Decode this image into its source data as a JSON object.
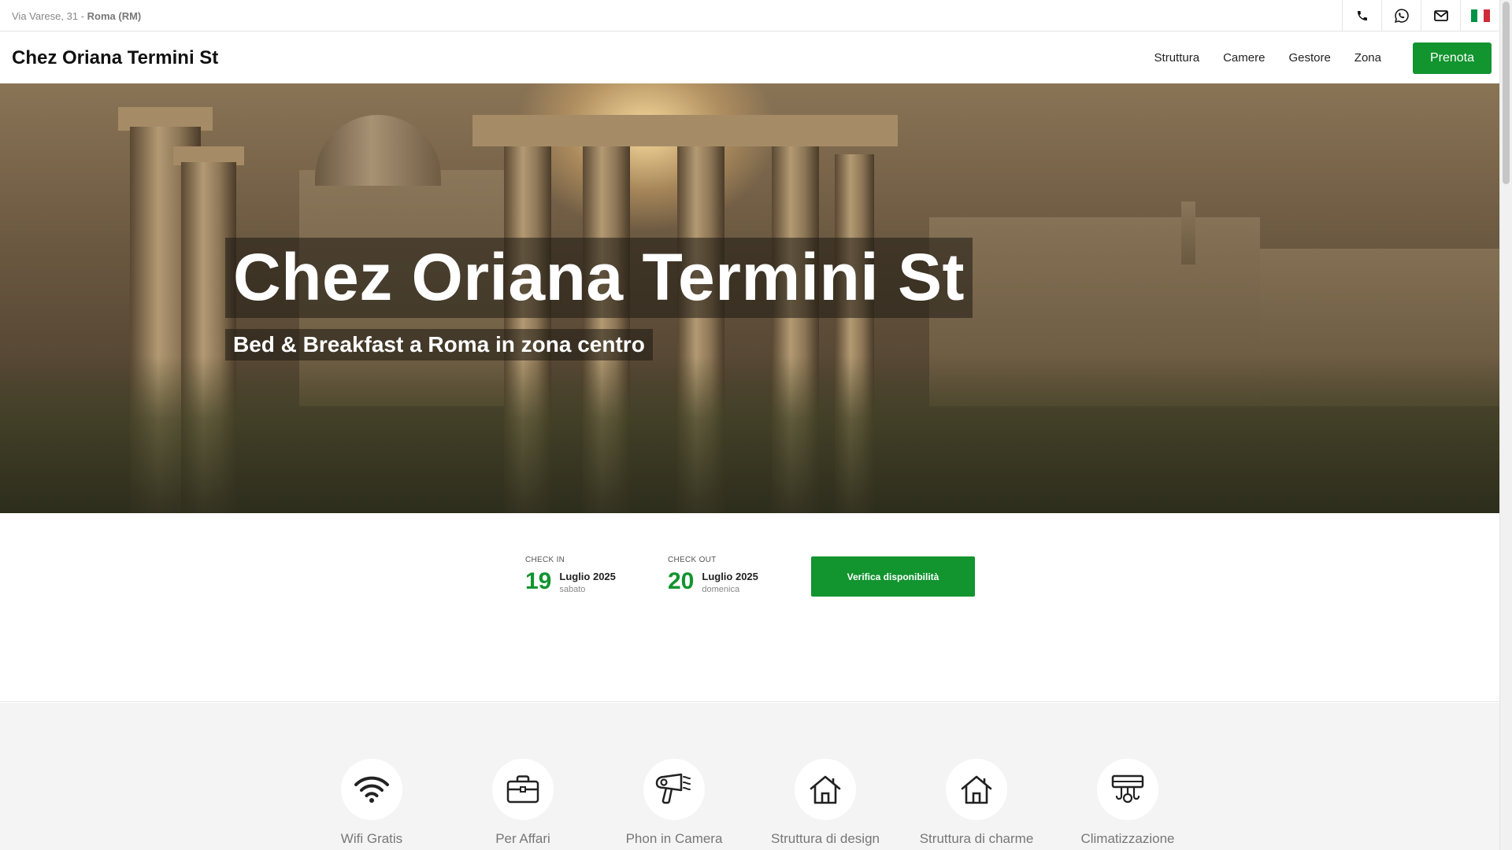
{
  "topbar": {
    "address_street": "Via Varese, 31 - ",
    "address_city": "Roma (RM)",
    "icons": [
      "phone-icon",
      "whatsapp-icon",
      "envelope-icon",
      "italian-flag-icon"
    ],
    "flag_colors": [
      "#009246",
      "#ffffff",
      "#ce2b37"
    ]
  },
  "navbar": {
    "brand": "Chez Oriana Termini St",
    "links": [
      "Struttura",
      "Camere",
      "Gestore",
      "Zona"
    ],
    "book_label": "Prenota"
  },
  "hero": {
    "title": "Chez Oriana Termini St",
    "subtitle": "Bed & Breakfast a Roma in zona centro"
  },
  "booking": {
    "checkin": {
      "label": "CHECK IN",
      "day": "19",
      "month": "Luglio 2025",
      "weekday": "sabato"
    },
    "checkout": {
      "label": "CHECK OUT",
      "day": "20",
      "month": "Luglio 2025",
      "weekday": "domenica"
    },
    "button_label": "Verifica disponibilità"
  },
  "amenities": [
    {
      "label": "Wifi Gratis",
      "icon": "wifi-icon"
    },
    {
      "label": "Per Affari",
      "icon": "briefcase-icon"
    },
    {
      "label": "Phon in Camera",
      "icon": "hairdryer-icon"
    },
    {
      "label": "Struttura di design",
      "icon": "house-icon"
    },
    {
      "label": "Struttura di charme",
      "icon": "house-icon"
    },
    {
      "label": "Climatizzazione",
      "icon": "air-conditioner-icon"
    }
  ],
  "colors": {
    "accent": "#12942f"
  }
}
